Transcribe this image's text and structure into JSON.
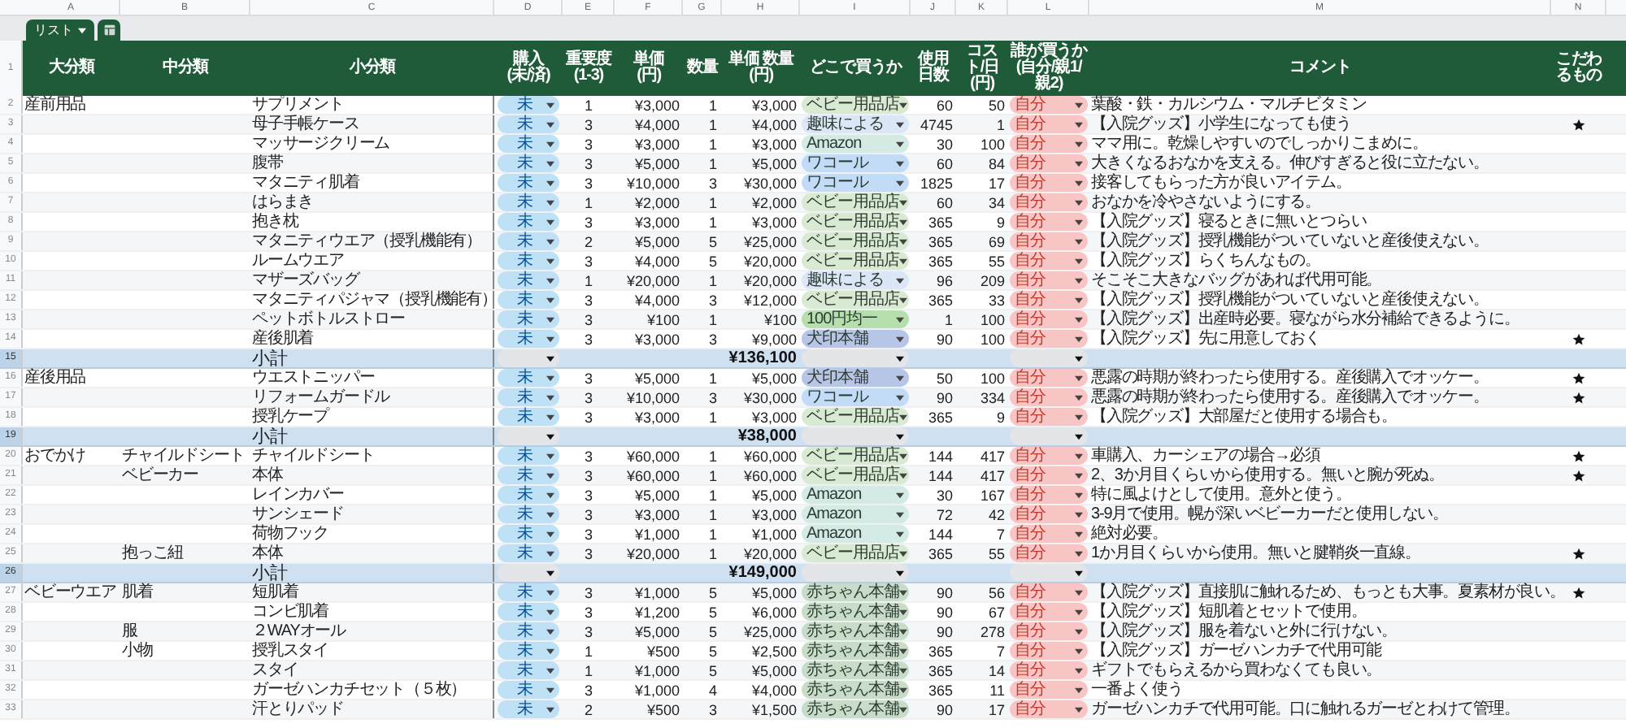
{
  "column_letters": [
    "A",
    "B",
    "C",
    "D",
    "E",
    "F",
    "G",
    "H",
    "I",
    "J",
    "K",
    "L",
    "M",
    "N"
  ],
  "sheet_tab": {
    "label": "リスト",
    "selected": true
  },
  "header_row_number": "1",
  "columns": [
    {
      "label": "大分類"
    },
    {
      "label": "中分類"
    },
    {
      "label": "小分類"
    },
    {
      "label": "購入",
      "note": "(未/済)"
    },
    {
      "label": "重要度",
      "note": "(1-3)"
    },
    {
      "label": "単価",
      "note": "(円)"
    },
    {
      "label": "数量"
    },
    {
      "label": "単価 数量",
      "note": "(円)"
    },
    {
      "label": "どこで買うか"
    },
    {
      "label": "使用日数"
    },
    {
      "label": "コスト/日",
      "note": "(円)"
    },
    {
      "label": "誰が買うか",
      "note": "(自分/親1/親2)"
    },
    {
      "label": "コメント"
    },
    {
      "label": "こだわるもの"
    }
  ],
  "rows": [
    {
      "kind": "item",
      "row": "2",
      "major": "産前用品",
      "minor": "サプリメント",
      "purchase": "未",
      "importance": "1",
      "unit_price": "¥3,000",
      "quantity": "1",
      "total": "¥3,000",
      "store": {
        "label": "ベビー用品店",
        "color": "#d9ead3"
      },
      "days": "60",
      "cost_per_day": "50",
      "buyer": "自分",
      "comment": "葉酸・鉄・カルシウム・マルチビタミン",
      "preferred": false
    },
    {
      "kind": "item",
      "row": "3",
      "minor": "母子手帳ケース",
      "purchase": "未",
      "importance": "3",
      "unit_price": "¥4,000",
      "quantity": "1",
      "total": "¥4,000",
      "store": {
        "label": "趣味による",
        "color": "#dbe7f7"
      },
      "days": "4745",
      "cost_per_day": "1",
      "buyer": "自分",
      "comment": "【入院グッズ】小学生になっても使う",
      "preferred": true
    },
    {
      "kind": "item",
      "row": "4",
      "minor": "マッサージクリーム",
      "purchase": "未",
      "importance": "3",
      "unit_price": "¥3,000",
      "quantity": "1",
      "total": "¥3,000",
      "store": {
        "label": "Amazon",
        "color": "#d4ebe5"
      },
      "days": "30",
      "cost_per_day": "100",
      "buyer": "自分",
      "comment": "ママ用に。乾燥しやすいのでしっかりこまめに。",
      "preferred": false
    },
    {
      "kind": "item",
      "row": "5",
      "minor": "腹帯",
      "purchase": "未",
      "importance": "3",
      "unit_price": "¥5,000",
      "quantity": "1",
      "total": "¥5,000",
      "store": {
        "label": "ワコール",
        "color": "#c2dcf7"
      },
      "days": "60",
      "cost_per_day": "84",
      "buyer": "自分",
      "comment": "大きくなるおなかを支える。伸びすぎると役に立たない。",
      "preferred": false
    },
    {
      "kind": "item",
      "row": "6",
      "minor": "マタニティ肌着",
      "purchase": "未",
      "importance": "3",
      "unit_price": "¥10,000",
      "quantity": "3",
      "total": "¥30,000",
      "store": {
        "label": "ワコール",
        "color": "#c2dcf7"
      },
      "days": "1825",
      "cost_per_day": "17",
      "buyer": "自分",
      "comment": "接客してもらった方が良いアイテム。",
      "preferred": false
    },
    {
      "kind": "item",
      "row": "7",
      "minor": "はらまき",
      "purchase": "未",
      "importance": "1",
      "unit_price": "¥2,000",
      "quantity": "1",
      "total": "¥2,000",
      "store": {
        "label": "ベビー用品店",
        "color": "#d9ead3"
      },
      "days": "60",
      "cost_per_day": "34",
      "buyer": "自分",
      "comment": "おなかを冷やさないようにする。",
      "preferred": false
    },
    {
      "kind": "item",
      "row": "8",
      "minor": "抱き枕",
      "purchase": "未",
      "importance": "3",
      "unit_price": "¥3,000",
      "quantity": "1",
      "total": "¥3,000",
      "store": {
        "label": "ベビー用品店",
        "color": "#d9ead3"
      },
      "days": "365",
      "cost_per_day": "9",
      "buyer": "自分",
      "comment": "【入院グッズ】寝るときに無いとつらい",
      "preferred": false
    },
    {
      "kind": "item",
      "row": "9",
      "minor": "マタニティウエア（授乳機能有）",
      "purchase": "未",
      "importance": "2",
      "unit_price": "¥5,000",
      "quantity": "5",
      "total": "¥25,000",
      "store": {
        "label": "ベビー用品店",
        "color": "#d9ead3"
      },
      "days": "365",
      "cost_per_day": "69",
      "buyer": "自分",
      "comment": "【入院グッズ】授乳機能がついていないと産後使えない。",
      "preferred": false
    },
    {
      "kind": "item",
      "row": "10",
      "minor": "ルームウエア",
      "purchase": "未",
      "importance": "3",
      "unit_price": "¥4,000",
      "quantity": "5",
      "total": "¥20,000",
      "store": {
        "label": "ベビー用品店",
        "color": "#d9ead3"
      },
      "days": "365",
      "cost_per_day": "55",
      "buyer": "自分",
      "comment": "【入院グッズ】らくちんなもの。",
      "preferred": false
    },
    {
      "kind": "item",
      "row": "11",
      "minor": "マザーズバッグ",
      "purchase": "未",
      "importance": "1",
      "unit_price": "¥20,000",
      "quantity": "1",
      "total": "¥20,000",
      "store": {
        "label": "趣味による",
        "color": "#dbe7f7"
      },
      "days": "96",
      "cost_per_day": "209",
      "buyer": "自分",
      "comment": "そこそこ大きなバッグがあれば代用可能。",
      "preferred": false
    },
    {
      "kind": "item",
      "row": "12",
      "minor": "マタニティパジャマ（授乳機能有）",
      "purchase": "未",
      "importance": "3",
      "unit_price": "¥4,000",
      "quantity": "3",
      "total": "¥12,000",
      "store": {
        "label": "ベビー用品店",
        "color": "#d9ead3"
      },
      "days": "365",
      "cost_per_day": "33",
      "buyer": "自分",
      "comment": "【入院グッズ】授乳機能がついていないと産後使えない。",
      "preferred": false
    },
    {
      "kind": "item",
      "row": "13",
      "minor": "ペットボトルストロー",
      "purchase": "未",
      "importance": "3",
      "unit_price": "¥100",
      "quantity": "1",
      "total": "¥100",
      "store": {
        "label": "100円均一",
        "color": "#b6dfae"
      },
      "days": "1",
      "cost_per_day": "100",
      "buyer": "自分",
      "comment": "【入院グッズ】出産時必要。寝ながら水分補給できるように。",
      "preferred": false
    },
    {
      "kind": "item",
      "row": "14",
      "minor": "産後肌着",
      "purchase": "未",
      "importance": "3",
      "unit_price": "¥3,000",
      "quantity": "3",
      "total": "¥9,000",
      "store": {
        "label": "犬印本舗",
        "color": "#b7c5e6"
      },
      "days": "90",
      "cost_per_day": "100",
      "buyer": "自分",
      "comment": "【入院グッズ】先に用意しておく",
      "preferred": true
    },
    {
      "kind": "subtotal",
      "row": "15",
      "label": "小計",
      "total": "¥136,100"
    },
    {
      "kind": "item",
      "row": "16",
      "major": "産後用品",
      "minor": "ウエストニッパー",
      "purchase": "未",
      "importance": "3",
      "unit_price": "¥5,000",
      "quantity": "1",
      "total": "¥5,000",
      "store": {
        "label": "犬印本舗",
        "color": "#b7c5e6"
      },
      "days": "50",
      "cost_per_day": "100",
      "buyer": "自分",
      "comment": "悪露の時期が終わったら使用する。産後購入でオッケー。",
      "preferred": true
    },
    {
      "kind": "item",
      "row": "17",
      "minor": "リフォームガードル",
      "purchase": "未",
      "importance": "3",
      "unit_price": "¥10,000",
      "quantity": "3",
      "total": "¥30,000",
      "store": {
        "label": "ワコール",
        "color": "#c2dcf7"
      },
      "days": "90",
      "cost_per_day": "334",
      "buyer": "自分",
      "comment": "悪露の時期が終わったら使用する。産後購入でオッケー。",
      "preferred": true
    },
    {
      "kind": "item",
      "row": "18",
      "minor": "授乳ケープ",
      "purchase": "未",
      "importance": "3",
      "unit_price": "¥3,000",
      "quantity": "1",
      "total": "¥3,000",
      "store": {
        "label": "ベビー用品店",
        "color": "#d9ead3"
      },
      "days": "365",
      "cost_per_day": "9",
      "buyer": "自分",
      "comment": "【入院グッズ】大部屋だと使用する場合も。",
      "preferred": false
    },
    {
      "kind": "subtotal",
      "row": "19",
      "label": "小計",
      "total": "¥38,000"
    },
    {
      "kind": "item",
      "row": "20",
      "major": "おでかけ",
      "middle": "チャイルドシート",
      "minor": "チャイルドシート",
      "purchase": "未",
      "importance": "3",
      "unit_price": "¥60,000",
      "quantity": "1",
      "total": "¥60,000",
      "store": {
        "label": "ベビー用品店",
        "color": "#d9ead3"
      },
      "days": "144",
      "cost_per_day": "417",
      "buyer": "自分",
      "comment": "車購入、カーシェアの場合→必須",
      "preferred": true
    },
    {
      "kind": "item",
      "row": "21",
      "middle": "ベビーカー",
      "minor": "本体",
      "purchase": "未",
      "importance": "3",
      "unit_price": "¥60,000",
      "quantity": "1",
      "total": "¥60,000",
      "store": {
        "label": "ベビー用品店",
        "color": "#d9ead3"
      },
      "days": "144",
      "cost_per_day": "417",
      "buyer": "自分",
      "comment": "2、3か月目くらいから使用する。無いと腕が死ぬ。",
      "preferred": true
    },
    {
      "kind": "item",
      "row": "22",
      "minor": "レインカバー",
      "purchase": "未",
      "importance": "3",
      "unit_price": "¥5,000",
      "quantity": "1",
      "total": "¥5,000",
      "store": {
        "label": "Amazon",
        "color": "#d4ebe5"
      },
      "days": "30",
      "cost_per_day": "167",
      "buyer": "自分",
      "comment": "特に風よけとして使用。意外と使う。",
      "preferred": false
    },
    {
      "kind": "item",
      "row": "23",
      "minor": "サンシェード",
      "purchase": "未",
      "importance": "3",
      "unit_price": "¥3,000",
      "quantity": "1",
      "total": "¥3,000",
      "store": {
        "label": "Amazon",
        "color": "#d4ebe5"
      },
      "days": "72",
      "cost_per_day": "42",
      "buyer": "自分",
      "comment": "3-9月で使用。幌が深いベビーカーだと使用しない。",
      "preferred": false
    },
    {
      "kind": "item",
      "row": "24",
      "minor": "荷物フック",
      "purchase": "未",
      "importance": "3",
      "unit_price": "¥1,000",
      "quantity": "1",
      "total": "¥1,000",
      "store": {
        "label": "Amazon",
        "color": "#d4ebe5"
      },
      "days": "144",
      "cost_per_day": "7",
      "buyer": "自分",
      "comment": "絶対必要。",
      "preferred": false
    },
    {
      "kind": "item",
      "row": "25",
      "middle": "抱っこ紐",
      "minor": "本体",
      "purchase": "未",
      "importance": "3",
      "unit_price": "¥20,000",
      "quantity": "1",
      "total": "¥20,000",
      "store": {
        "label": "ベビー用品店",
        "color": "#d9ead3"
      },
      "days": "365",
      "cost_per_day": "55",
      "buyer": "自分",
      "comment": "1か月目くらいから使用。無いと腱鞘炎一直線。",
      "preferred": true
    },
    {
      "kind": "subtotal",
      "row": "26",
      "label": "小計",
      "total": "¥149,000"
    },
    {
      "kind": "item",
      "row": "27",
      "major": "ベビーウエア",
      "middle": "肌着",
      "minor": "短肌着",
      "purchase": "未",
      "importance": "3",
      "unit_price": "¥1,000",
      "quantity": "5",
      "total": "¥5,000",
      "store": {
        "label": "赤ちゃん本舗",
        "color": "#c8ddc8"
      },
      "days": "90",
      "cost_per_day": "56",
      "buyer": "自分",
      "comment": "【入院グッズ】直接肌に触れるため、もっとも大事。夏素材が良い。",
      "preferred": true
    },
    {
      "kind": "item",
      "row": "28",
      "minor": "コンビ肌着",
      "purchase": "未",
      "importance": "3",
      "unit_price": "¥1,200",
      "quantity": "5",
      "total": "¥6,000",
      "store": {
        "label": "赤ちゃん本舗",
        "color": "#c8ddc8"
      },
      "days": "90",
      "cost_per_day": "67",
      "buyer": "自分",
      "comment": "【入院グッズ】短肌着とセットで使用。",
      "preferred": false
    },
    {
      "kind": "item",
      "row": "29",
      "middle": "服",
      "minor": "２WAYオール",
      "purchase": "未",
      "importance": "3",
      "unit_price": "¥5,000",
      "quantity": "5",
      "total": "¥25,000",
      "store": {
        "label": "赤ちゃん本舗",
        "color": "#c8ddc8"
      },
      "days": "90",
      "cost_per_day": "278",
      "buyer": "自分",
      "comment": "【入院グッズ】服を着ないと外に行けない。",
      "preferred": false
    },
    {
      "kind": "item",
      "row": "30",
      "middle": "小物",
      "minor": "授乳スタイ",
      "purchase": "未",
      "importance": "1",
      "unit_price": "¥500",
      "quantity": "5",
      "total": "¥2,500",
      "store": {
        "label": "赤ちゃん本舗",
        "color": "#c8ddc8"
      },
      "days": "365",
      "cost_per_day": "7",
      "buyer": "自分",
      "comment": "【入院グッズ】ガーゼハンカチで代用可能",
      "preferred": false
    },
    {
      "kind": "item",
      "row": "31",
      "minor": "スタイ",
      "purchase": "未",
      "importance": "1",
      "unit_price": "¥1,000",
      "quantity": "5",
      "total": "¥5,000",
      "store": {
        "label": "赤ちゃん本舗",
        "color": "#c8ddc8"
      },
      "days": "365",
      "cost_per_day": "14",
      "buyer": "自分",
      "comment": "ギフトでもらえるから買わなくても良い。",
      "preferred": false
    },
    {
      "kind": "item",
      "row": "32",
      "minor": "ガーゼハンカチセット（５枚）",
      "purchase": "未",
      "importance": "3",
      "unit_price": "¥1,000",
      "quantity": "4",
      "total": "¥4,000",
      "store": {
        "label": "赤ちゃん本舗",
        "color": "#c8ddc8"
      },
      "days": "365",
      "cost_per_day": "11",
      "buyer": "自分",
      "comment": "一番よく使う",
      "preferred": false
    },
    {
      "kind": "item",
      "row": "33",
      "minor": "汗とりパッド",
      "purchase": "未",
      "importance": "2",
      "unit_price": "¥500",
      "quantity": "3",
      "total": "¥1,500",
      "store": {
        "label": "赤ちゃん本舗",
        "color": "#c8ddc8"
      },
      "days": "90",
      "cost_per_day": "17",
      "buyer": "自分",
      "comment": "ガーゼハンカチで代用可能。口に触れるガーゼとわけて管理。",
      "preferred": false
    }
  ]
}
